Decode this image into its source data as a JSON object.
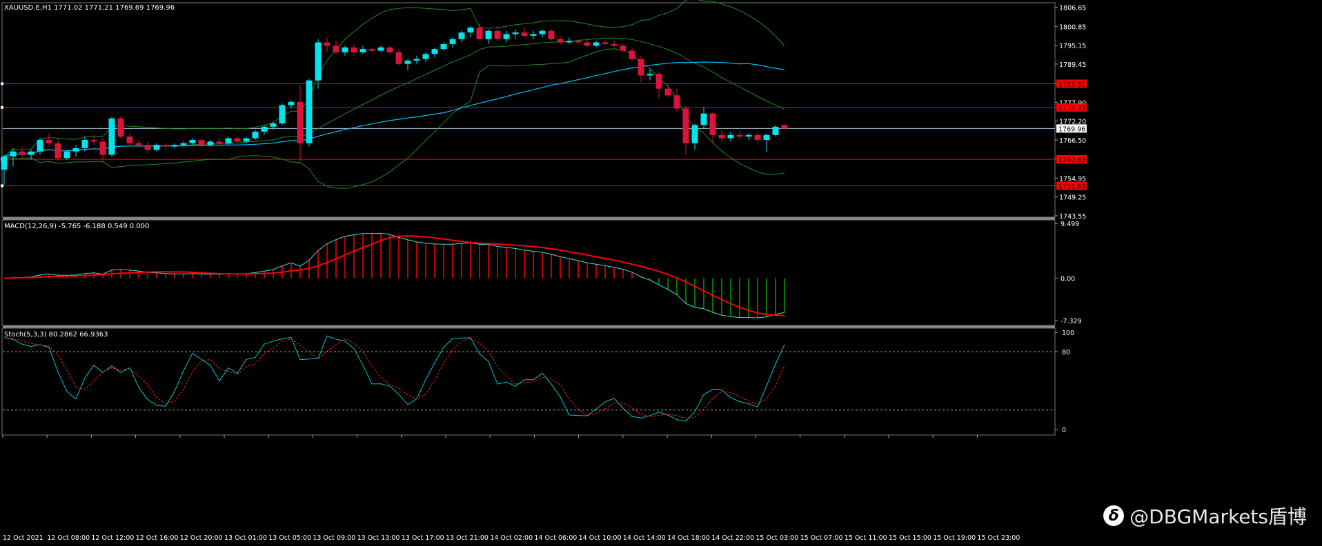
{
  "header": {
    "symbol": "XAUUSD.E,H1",
    "ohlc": "1771.02 1771.21 1769.69 1769.96"
  },
  "indicators": {
    "macd_label": "MACD(12,26,9) -5.765 -6.188 0.549 0.000",
    "stoch_label": "Stoch(5,3,3) 80.2862 66.9363"
  },
  "watermark": {
    "text": "@DBGMarkets盾博",
    "logo_icon": "weibo-style-logo-icon"
  },
  "colors": {
    "background": "#000000",
    "bull_candle": "#00e5ee",
    "bear_candle": "#dc143c",
    "bollinger": "#228b22",
    "ma_line": "#00bfff",
    "hline": "#ff0000",
    "price_line": "#b0c4de",
    "macd_main": "#40e0d0",
    "macd_signal": "#ff0000",
    "hist_pos": "#ff0000",
    "hist_neg": "#00a000",
    "stoch_main": "#00c8d0",
    "stoch_signal": "#ff2020"
  },
  "chart_data": {
    "type": "candlestick",
    "price_axis": {
      "ticks": [
        "1806.65",
        "1800.85",
        "1795.15",
        "1789.45",
        "1783.75",
        "1777.90",
        "1772.20",
        "1766.50",
        "1760.80",
        "1754.95",
        "1749.25",
        "1743.55"
      ],
      "range": [
        1743.55,
        1808
      ]
    },
    "current_price": "1769.96",
    "horizontal_levels": [
      {
        "value": "1783.51",
        "price": 1783.51
      },
      {
        "value": "1776.33",
        "price": 1776.33
      },
      {
        "value": "1760.63",
        "price": 1760.63
      },
      {
        "value": "1752.63",
        "price": 1752.63
      }
    ],
    "time_labels": [
      "12 Oct 2021",
      "12 Oct 08:00",
      "12 Oct 12:00",
      "12 Oct 16:00",
      "12 Oct 20:00",
      "13 Oct 01:00",
      "13 Oct 05:00",
      "13 Oct 09:00",
      "13 Oct 13:00",
      "13 Oct 17:00",
      "13 Oct 21:00",
      "14 Oct 02:00",
      "14 Oct 06:00",
      "14 Oct 10:00",
      "14 Oct 14:00",
      "14 Oct 18:00",
      "14 Oct 22:00",
      "15 Oct 03:00",
      "15 Oct 07:00",
      "15 Oct 11:00",
      "15 Oct 15:00",
      "15 Oct 19:00",
      "15 Oct 23:00"
    ],
    "candles": [
      [
        1757.5,
        1762.0,
        1753.0,
        1761.5
      ],
      [
        1761.5,
        1764.0,
        1758.5,
        1763.0
      ],
      [
        1763.0,
        1764.5,
        1761.0,
        1762.0
      ],
      [
        1762.0,
        1763.5,
        1760.5,
        1763.0
      ],
      [
        1763.0,
        1767.0,
        1762.0,
        1766.5
      ],
      [
        1766.5,
        1768.5,
        1764.5,
        1765.5
      ],
      [
        1765.5,
        1767.0,
        1760.0,
        1761.0
      ],
      [
        1761.0,
        1763.5,
        1760.5,
        1763.0
      ],
      [
        1763.0,
        1765.0,
        1761.5,
        1764.0
      ],
      [
        1764.0,
        1767.5,
        1763.0,
        1766.5
      ],
      [
        1766.5,
        1768.0,
        1765.0,
        1766.0
      ],
      [
        1766.0,
        1767.0,
        1760.0,
        1762.0
      ],
      [
        1762.0,
        1773.5,
        1761.5,
        1773.0
      ],
      [
        1773.0,
        1773.8,
        1767.0,
        1767.5
      ],
      [
        1767.5,
        1768.5,
        1764.5,
        1765.5
      ],
      [
        1765.5,
        1766.5,
        1764.0,
        1765.0
      ],
      [
        1765.0,
        1766.0,
        1762.5,
        1763.5
      ],
      [
        1763.5,
        1765.5,
        1763.0,
        1765.0
      ],
      [
        1765.0,
        1765.5,
        1763.5,
        1764.5
      ],
      [
        1764.5,
        1765.5,
        1764.0,
        1765.0
      ],
      [
        1765.0,
        1766.0,
        1764.5,
        1765.5
      ],
      [
        1765.5,
        1767.0,
        1765.0,
        1766.5
      ],
      [
        1766.5,
        1767.0,
        1764.5,
        1765.0
      ],
      [
        1765.0,
        1766.5,
        1764.5,
        1766.0
      ],
      [
        1766.0,
        1767.0,
        1765.0,
        1765.5
      ],
      [
        1765.5,
        1767.5,
        1765.0,
        1767.0
      ],
      [
        1767.0,
        1767.5,
        1765.5,
        1766.0
      ],
      [
        1766.0,
        1767.5,
        1765.5,
        1767.0
      ],
      [
        1767.0,
        1769.5,
        1766.5,
        1769.0
      ],
      [
        1769.0,
        1771.0,
        1768.0,
        1770.5
      ],
      [
        1770.5,
        1772.0,
        1769.5,
        1771.5
      ],
      [
        1771.5,
        1777.5,
        1771.0,
        1777.0
      ],
      [
        1777.0,
        1778.5,
        1776.0,
        1778.0
      ],
      [
        1778.0,
        1783.0,
        1760.0,
        1765.5
      ],
      [
        1765.5,
        1785.0,
        1764.5,
        1784.5
      ],
      [
        1784.5,
        1797.0,
        1782.0,
        1796.0
      ],
      [
        1796.0,
        1797.5,
        1793.0,
        1795.0
      ],
      [
        1795.0,
        1796.5,
        1792.5,
        1793.0
      ],
      [
        1793.0,
        1795.0,
        1792.0,
        1794.5
      ],
      [
        1794.5,
        1795.5,
        1792.0,
        1793.0
      ],
      [
        1793.0,
        1795.0,
        1792.5,
        1794.0
      ],
      [
        1794.0,
        1794.5,
        1793.0,
        1793.5
      ],
      [
        1793.5,
        1795.0,
        1793.0,
        1794.5
      ],
      [
        1794.5,
        1795.0,
        1792.5,
        1793.0
      ],
      [
        1793.0,
        1794.0,
        1789.0,
        1789.5
      ],
      [
        1789.5,
        1791.0,
        1787.5,
        1790.5
      ],
      [
        1790.5,
        1792.0,
        1789.5,
        1791.0
      ],
      [
        1791.0,
        1793.0,
        1790.0,
        1792.5
      ],
      [
        1792.5,
        1794.5,
        1791.5,
        1794.0
      ],
      [
        1794.0,
        1796.0,
        1793.5,
        1795.5
      ],
      [
        1795.5,
        1797.5,
        1794.5,
        1797.0
      ],
      [
        1797.0,
        1799.5,
        1796.0,
        1799.0
      ],
      [
        1799.0,
        1801.0,
        1797.5,
        1800.5
      ],
      [
        1800.5,
        1801.5,
        1796.5,
        1797.0
      ],
      [
        1797.0,
        1800.0,
        1795.5,
        1799.5
      ],
      [
        1799.5,
        1801.0,
        1796.5,
        1797.0
      ],
      [
        1797.0,
        1799.5,
        1796.0,
        1798.5
      ],
      [
        1798.5,
        1800.0,
        1797.0,
        1799.0
      ],
      [
        1799.0,
        1800.5,
        1797.5,
        1798.0
      ],
      [
        1798.0,
        1799.5,
        1797.0,
        1798.5
      ],
      [
        1798.5,
        1800.0,
        1797.5,
        1799.5
      ],
      [
        1799.5,
        1800.0,
        1796.5,
        1797.0
      ],
      [
        1797.0,
        1798.0,
        1795.5,
        1796.0
      ],
      [
        1796.0,
        1797.5,
        1795.5,
        1796.5
      ],
      [
        1796.5,
        1797.0,
        1795.5,
        1796.0
      ],
      [
        1796.0,
        1797.0,
        1794.5,
        1795.0
      ],
      [
        1795.0,
        1796.5,
        1794.5,
        1796.0
      ],
      [
        1796.0,
        1797.0,
        1795.0,
        1795.5
      ],
      [
        1795.5,
        1796.5,
        1794.5,
        1795.0
      ],
      [
        1795.0,
        1795.5,
        1793.0,
        1793.5
      ],
      [
        1793.5,
        1794.5,
        1790.5,
        1791.0
      ],
      [
        1791.0,
        1792.0,
        1784.0,
        1786.0
      ],
      [
        1786.0,
        1788.0,
        1784.5,
        1786.5
      ],
      [
        1786.5,
        1787.0,
        1779.0,
        1782.0
      ],
      [
        1782.0,
        1783.5,
        1779.5,
        1780.0
      ],
      [
        1780.0,
        1782.0,
        1775.0,
        1776.0
      ],
      [
        1776.0,
        1777.0,
        1762.0,
        1765.5
      ],
      [
        1765.5,
        1771.5,
        1763.5,
        1771.0
      ],
      [
        1771.0,
        1776.5,
        1770.0,
        1774.5
      ],
      [
        1774.5,
        1775.0,
        1765.5,
        1768.0
      ],
      [
        1768.0,
        1769.5,
        1766.0,
        1767.0
      ],
      [
        1767.0,
        1769.0,
        1766.0,
        1768.0
      ],
      [
        1768.0,
        1769.0,
        1766.5,
        1767.5
      ],
      [
        1767.5,
        1768.5,
        1766.5,
        1768.0
      ],
      [
        1768.0,
        1769.0,
        1765.5,
        1766.5
      ],
      [
        1766.5,
        1768.5,
        1763.0,
        1768.0
      ],
      [
        1768.0,
        1771.0,
        1767.5,
        1770.5
      ],
      [
        1771.02,
        1771.21,
        1769.69,
        1769.96
      ]
    ]
  }
}
